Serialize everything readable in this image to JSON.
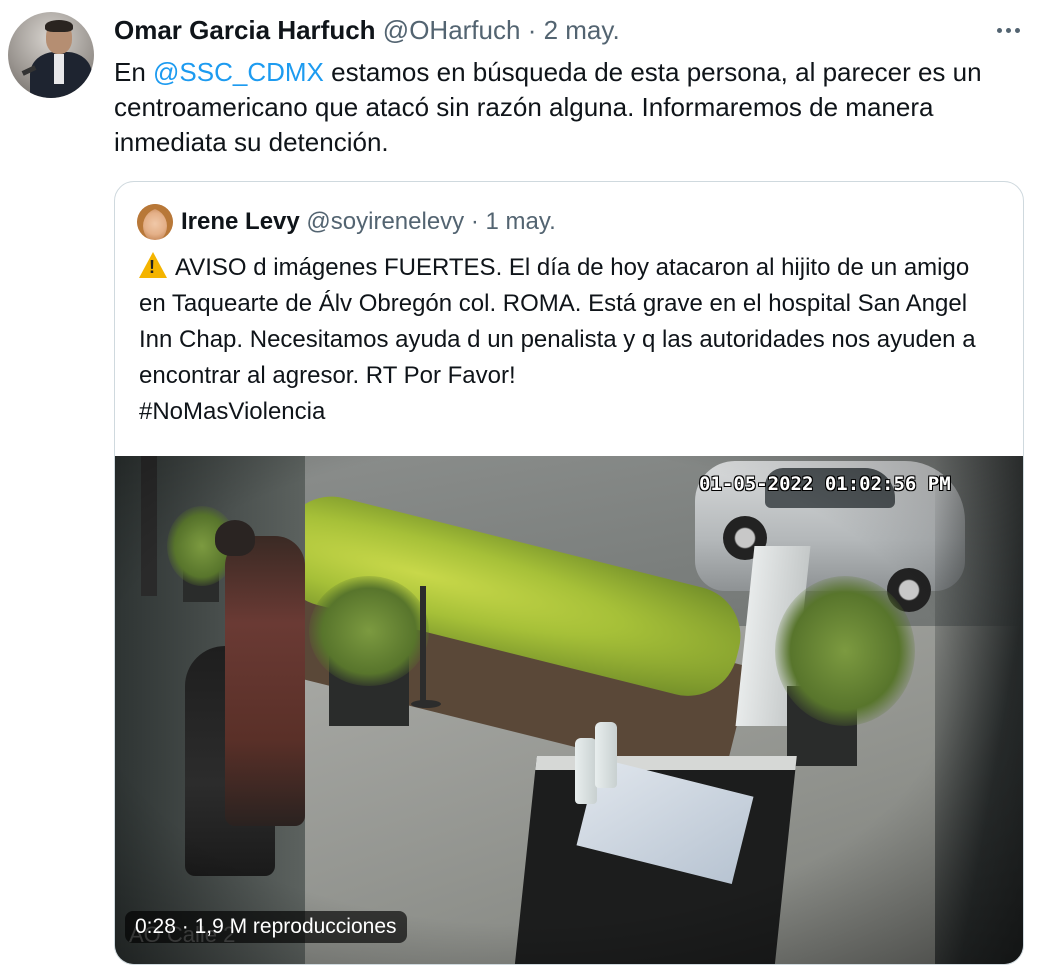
{
  "tweet": {
    "author_name": "Omar Garcia Harfuch",
    "author_handle": "@OHarfuch",
    "separator": "·",
    "date": "2 may.",
    "text_before": "En ",
    "mention": "@SSC_CDMX",
    "text_after": " estamos en búsqueda de esta persona, al parecer es un centroamericano que atacó sin razón alguna.  Informaremos de manera inmediata su detención."
  },
  "quote": {
    "author_name": "Irene Levy",
    "author_handle": "@soyirenelevy",
    "separator": "·",
    "date": "1 may.",
    "text_line1": "AVISO d imágenes FUERTES. El día de hoy atacaron al hijito de un amigo en Taquearte de Álv Obregón col. ROMA. Está grave en el hospital San Angel Inn Chap. Necesitamos ayuda d un penalista y q las autoridades nos ayuden a encontrar al agresor. RT Por Favor!",
    "hashtag": "#NoMasViolencia"
  },
  "video": {
    "timestamp": "01-05-2022 01:02:56 PM",
    "watermark": "AO Calle 2",
    "duration": "0:28",
    "separator": "·",
    "views": "1,9 M reproducciones"
  },
  "icons": {
    "more": "more-horizontal-icon",
    "warning": "warning-emoji-icon"
  },
  "colors": {
    "link": "#1d9bf0",
    "secondary_text": "#536471",
    "card_border": "#cfd9de"
  }
}
